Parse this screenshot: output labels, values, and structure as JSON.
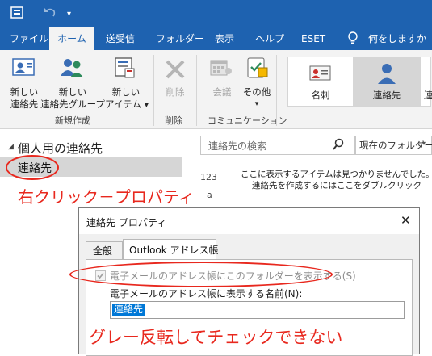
{
  "ribbon_tabs": {
    "file": "ファイル",
    "home": "ホーム",
    "send_receive": "送受信",
    "folder": "フォルダー",
    "view": "表示",
    "help": "ヘルプ",
    "eset": "ESET",
    "tell_me": "何をしますか"
  },
  "ribbon": {
    "new_contact": [
      "新しい",
      "連絡先"
    ],
    "new_contact_group": [
      "新しい",
      "連絡先グループ"
    ],
    "new_items": [
      "新しい",
      "アイテム ▾"
    ],
    "group_new": "新規作成",
    "delete": "削除",
    "group_delete": "削除",
    "meeting": "会議",
    "more": [
      "その他",
      "▾"
    ],
    "group_communication": "コミュニケーション",
    "view_card": "名刺",
    "view_contact": "連絡先",
    "view_cut": "連"
  },
  "nav": {
    "header": "個人用の連絡先",
    "item": "連絡先",
    "annotation": "右クリック－プロパティ"
  },
  "content": {
    "search_placeholder": "連絡先の検索",
    "scope": "現在のフォルダー",
    "index": "123",
    "index_tail": "a",
    "empty_line1": "ここに表示するアイテムは見つかりませんでした。",
    "empty_line2": "連絡先を作成するにはここをダブルクリック"
  },
  "dialog": {
    "title": "連絡先 プロパティ",
    "tab_general": "全般",
    "tab_addressbook": "Outlook アドレス帳",
    "checkbox_label": "電子メールのアドレス帳にこのフォルダーを表示する(S)",
    "checkbox_checked": true,
    "name_label": "電子メールのアドレス帳に表示する名前(N):",
    "name_value": "連絡先",
    "annotation": "グレー反転してチェックできない"
  },
  "colors": {
    "accent": "#1e62b0",
    "annotation": "#e8281e",
    "selected": "#d6d6d6"
  }
}
